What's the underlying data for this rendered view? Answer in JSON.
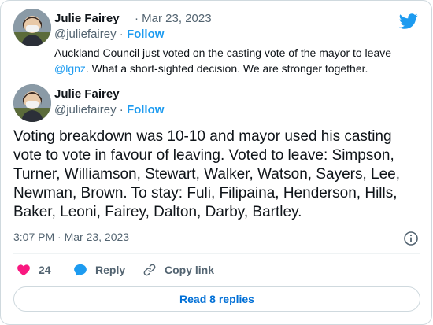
{
  "quoted_tweet": {
    "author_name": "Julie Fairey",
    "date": "Mar 23, 2023",
    "handle": "@juliefairey",
    "follow_label": "Follow",
    "text_part1": "Auckland Council just voted on the casting vote of the mayor to leave ",
    "mention": "@lgnz",
    "text_part2": ".  What a short-sighted decision.  We are stronger together."
  },
  "main_tweet": {
    "author_name": "Julie Fairey",
    "handle": "@juliefairey",
    "follow_label": "Follow",
    "text": "Voting breakdown was 10-10 and mayor used his casting vote to vote in favour of leaving.  Voted to leave: Simpson, Turner, Williamson, Stewart, Walker, Watson, Sayers, Lee, Newman, Brown.  To stay: Fuli, Filipaina, Henderson, Hills, Baker, Leoni, Fairey, Dalton, Darby, Bartley.",
    "timestamp": "3:07 PM · Mar 23, 2023"
  },
  "actions": {
    "like_count": "24",
    "reply_label": "Reply",
    "copy_link_label": "Copy link"
  },
  "read_replies_label": "Read 8 replies",
  "colors": {
    "accent": "#1d9bf0",
    "like": "#f91880",
    "text": "#0f1419",
    "secondary": "#536471"
  },
  "icons": [
    "twitter-bird-icon",
    "heart-icon",
    "reply-bubble-icon",
    "link-icon",
    "info-icon"
  ]
}
